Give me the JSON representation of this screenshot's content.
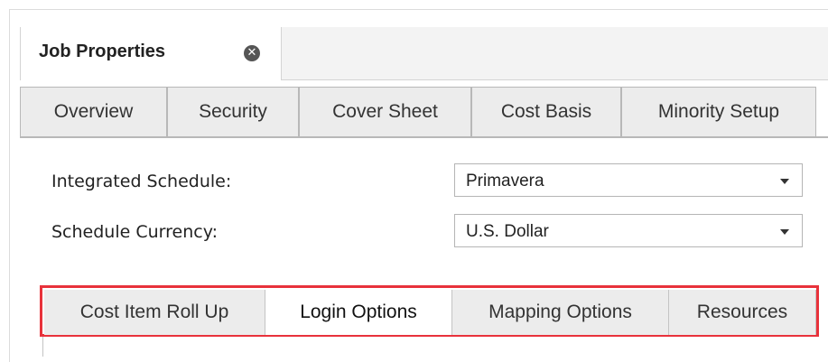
{
  "document_tab": {
    "title": "Job Properties",
    "close_icon": "close-circle-icon"
  },
  "tabs": [
    {
      "label": "Overview"
    },
    {
      "label": "Security"
    },
    {
      "label": "Cover Sheet"
    },
    {
      "label": "Cost Basis"
    },
    {
      "label": "Minority Setup"
    }
  ],
  "fields": {
    "integrated_schedule": {
      "label": "Integrated Schedule:",
      "value": "Primavera"
    },
    "schedule_currency": {
      "label": "Schedule Currency:",
      "value": "U.S. Dollar"
    }
  },
  "subtabs": [
    {
      "label": "Cost Item Roll Up"
    },
    {
      "label": "Login Options",
      "active": true
    },
    {
      "label": "Mapping Options"
    },
    {
      "label": "Resources"
    }
  ],
  "colors": {
    "highlight": "#e8323b",
    "tab_bg": "#ececec",
    "active_tab_bg": "#ffffff"
  }
}
